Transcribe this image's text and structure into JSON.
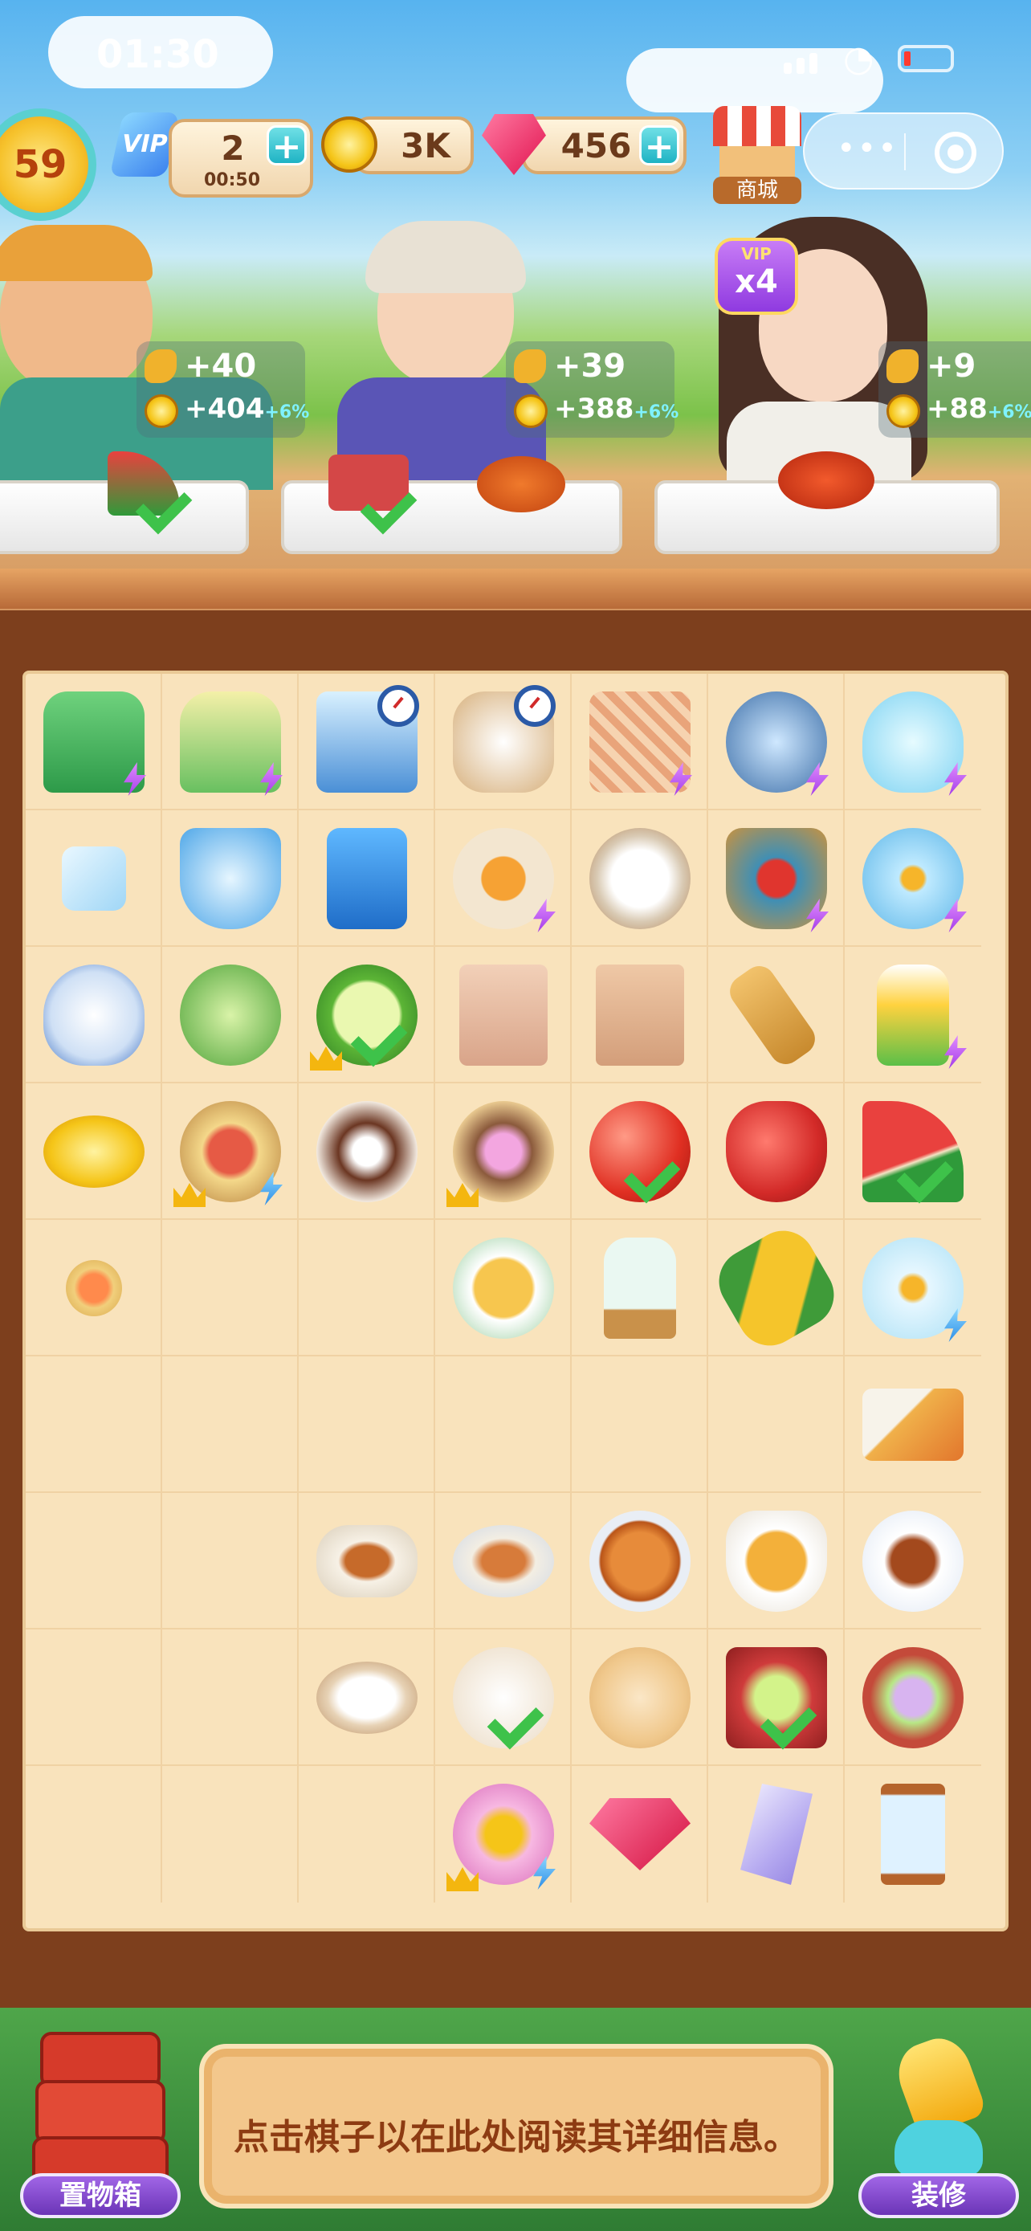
{
  "status_bar": {
    "time": "01:30"
  },
  "hud": {
    "level": "59",
    "vip_label": "VIP",
    "energy": {
      "value": "2",
      "timer": "00:50"
    },
    "coins": "3K",
    "gems": "456",
    "shop_label": "商城"
  },
  "customers": [
    {
      "wheat": "+40",
      "coins": "+404",
      "bonus": "+6%"
    },
    {
      "wheat": "+39",
      "coins": "+388",
      "bonus": "+6%"
    },
    {
      "wheat": "+9",
      "coins": "+88",
      "bonus": "+6%",
      "vip_badge": "VIP",
      "vip_multiplier": "x4"
    }
  ],
  "board": {
    "rows": [
      [
        "coffee-machine-icon",
        "juicer-icon",
        "ice-maker-icon",
        "rice-cooker-icon",
        "vegetable-basket-icon",
        "lunchbox-icon",
        "fish-bowl-icon"
      ],
      [
        "ice-cube-icon",
        "ice-bowl-icon",
        "fridge-icon",
        "soup-bowl-icon",
        "strainer-pan-icon",
        "cherry-basket-icon",
        "goldfish-bowl-icon"
      ],
      [
        "teapot-icon",
        "cabbage-icon",
        "cucumber-icon",
        "paper-bag-icon",
        "shopping-bag-icon",
        "spatula-icon",
        "juice-glass-icon"
      ],
      [
        "coin-stack-icon",
        "fish-platter-icon",
        "chocolate-cake-icon",
        "ice-cream-bowl-icon",
        "apple-icon",
        "strawberry-icon",
        "watermelon-icon"
      ],
      [
        "shrimp-dish-icon",
        "",
        "",
        "egg-soup-icon",
        "vase-icon",
        "corn-icon",
        "goldfish-bag-icon"
      ],
      [
        "",
        "",
        "",
        "",
        "",
        "",
        "fried-shrimp-icon"
      ],
      [
        "",
        "",
        "braised-dish-icon",
        "roast-meat-icon",
        "roast-chicken-icon",
        "broth-bowl-icon",
        "lemon-tea-icon"
      ],
      [
        "",
        "",
        "flour-bowl-icon",
        "steamed-bun-icon",
        "sesame-bun-icon",
        "jelly-dessert-box-icon",
        "flower-cake-plate-icon"
      ],
      [
        "",
        "",
        "",
        "piggy-bank-icon",
        "ruby-icon",
        "crystal-icon",
        "hourglass-icon"
      ]
    ]
  },
  "bottom": {
    "storage_label": "置物箱",
    "info_text": "点击棋子以在此处阅读其详细信息。",
    "decorate_label": "装修"
  },
  "colors": {
    "board_bg": "#f9e3bc",
    "frame": "#7d3f1d",
    "accent_purple": "#8f3ae0",
    "check_green": "#3ec24a"
  }
}
